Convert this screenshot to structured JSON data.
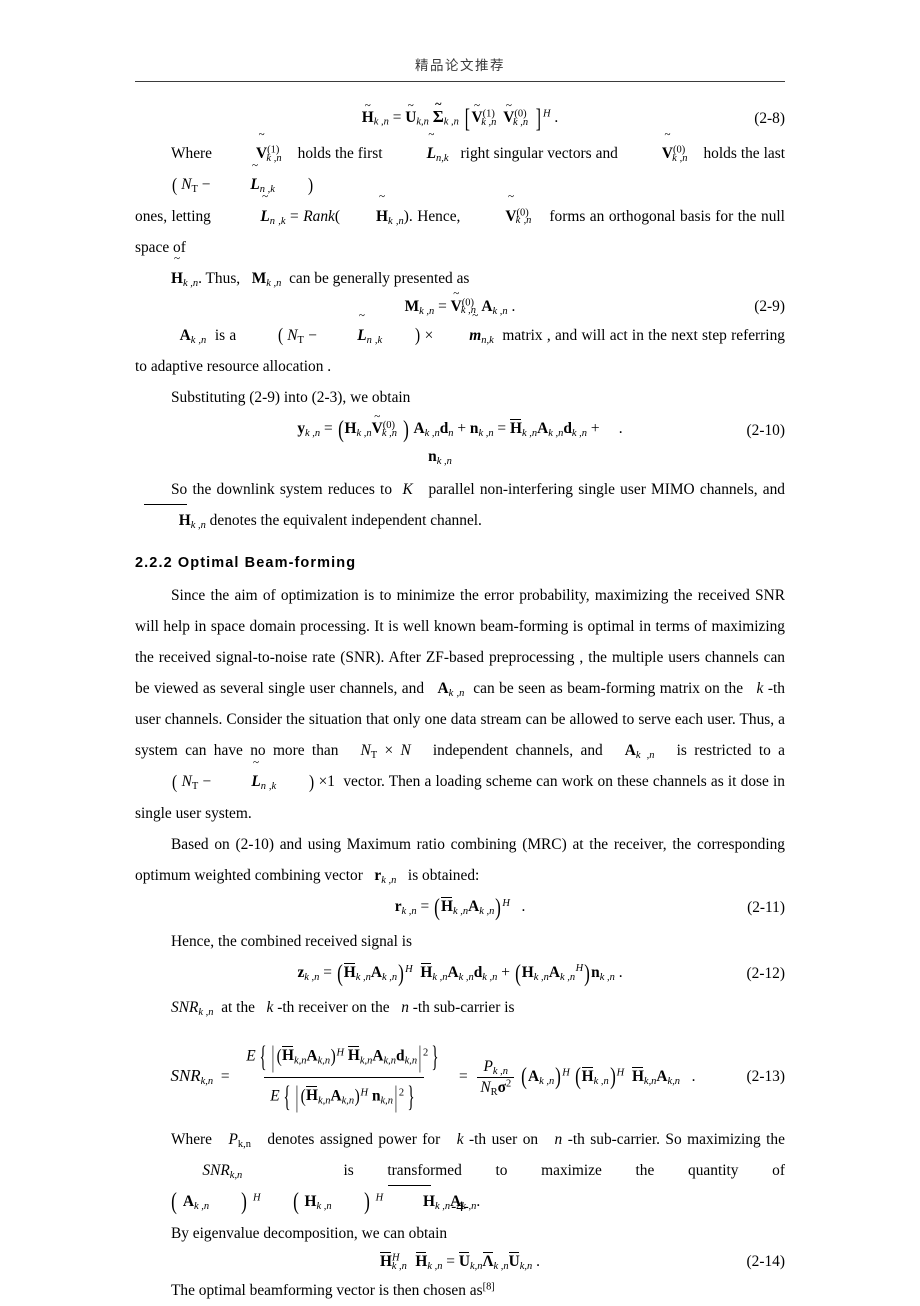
{
  "header": {
    "title": "精品论文推荐"
  },
  "equations": {
    "eq_2_8": {
      "number": "(2-8)",
      "latex": "H̃_{k,n} = Ũ_{k,n} Σ̃_{k,n} [ Ṽ^{(1)}_{k,n} Ṽ^{(0)}_{k,n} ]^{H} ."
    },
    "eq_2_9": {
      "number": "(2-9)",
      "latex": "M_{k,n} = Ṽ^{(0)}_{k,n} A_{k,n} ."
    },
    "eq_2_10": {
      "number": "(2-10)",
      "latex": "y_{k,n} = ( H_{k,n} Ṽ^{(0)}_{k,n} ) A_{k,n} d_{n} + n_{k,n} = H̄_{k,n} A_{k,n} d_{k,n} + n_{k,n} ."
    },
    "eq_2_11": {
      "number": "(2-11)",
      "latex": "r_{k,n} = ( H̄_{k,n} A_{k,n} )^{H} ."
    },
    "eq_2_12": {
      "number": "(2-12)",
      "latex": "z_{k,n} = ( H̄_{k,n} A_{k,n} )^{H} H̄_{k,n} A_{k,n} d_{k,n} + ( H_{k,n} A_{k,n} )^{H} n_{k,n} ."
    },
    "eq_2_13": {
      "number": "(2-13)",
      "latex": "SNR_{k,n} = E{ | ( H̄_{k,n} A_{k,n} )^{H} H̄_{k,n} A_{k,n} d_{k,n} |^{2} } / E{ | ( H̄_{k,n} A_{k,n} )^{H} n_{k,n} |^{2} } = ( P_{k,n} / ( N_R σ^{2} ) ) ( A_{k,n} )^{H} ( H̄_{k,n} )^{H} H̄_{k,n} A_{k,n} ."
    },
    "eq_2_14": {
      "number": "(2-14)",
      "latex": "H̄^{H}_{k,n} H̄_{k,n} = Ū_{k,n} Λ̄_{k,n} Ū_{k,n} ."
    }
  },
  "paragraphs": {
    "p1_a": "Where",
    "p1_b": "holds the first",
    "p1_c": "right singular vectors and",
    "p1_d": "holds the last",
    "p1_e": "ones, letting",
    "p1_f": ". Hence,",
    "p1_g": "forms an orthogonal basis for the null space of",
    "p1_h": ". Thus,",
    "p1_i": "can be generally presented as",
    "p2_a": "is a",
    "p2_b": "matrix , and will act in the next step referring to adaptive resource allocation .",
    "p3": "Substituting (2-9) into (2-3), we obtain",
    "p4_a": "So the downlink system reduces to",
    "p4_b": "parallel non-interfering single user MIMO channels, and",
    "p4_c": "denotes the equivalent independent channel.",
    "p5_a": "Since the aim of optimization is to minimize the error probability, maximizing the received SNR will help in space domain processing. It is well known beam-forming is optimal in terms of maximizing the received signal-to-noise rate (SNR). After ZF-based preprocessing , the multiple users channels can be viewed as several single user channels, and",
    "p5_b": "can be seen as beam-forming matrix on the",
    "p5_c": "-th user channels. Consider the situation that only one data stream can be allowed to serve each user. Thus, a system can have no more than",
    "p5_d": "independent channels, and",
    "p5_e": "is restricted to a",
    "p5_f": "vector. Then a loading scheme can work on these channels as it dose in single user system.",
    "p6_a": "Based on (2-10) and using Maximum ratio combining (MRC) at the receiver, the corresponding optimum weighted combining vector",
    "p6_b": "is obtained:",
    "p7": "Hence, the combined received signal is",
    "p8_a": "at the",
    "p8_b": "-th receiver on the",
    "p8_c": "-th sub-carrier is",
    "p9_a": "Where",
    "p9_b": "denotes assigned power for",
    "p9_c": "-th user on",
    "p9_d": "-th sub-carrier. So maximizing the",
    "p9_e": "is transformed to maximize the quantity of",
    "p9_f": ".",
    "p10": "By eigenvalue decomposition, we can obtain",
    "p11_a": "The optimal beamforming vector is then chosen as",
    "p11_ref": "[8]"
  },
  "section": {
    "heading": "2.2.2 Optimal Beam-forming"
  },
  "footer": {
    "page_number": "-4-"
  },
  "symbols": {
    "H": "H",
    "U": "U",
    "V": "V",
    "A": "A",
    "M": "M",
    "y": "y",
    "d": "d",
    "n": "n",
    "r": "r",
    "z": "z",
    "P": "P",
    "K": "K",
    "k": "k",
    "N_T": "N",
    "N_R": "N",
    "sigma": "σ",
    "Lambda": "Λ",
    "Sigma": "Σ",
    "E": "E",
    "Rank": "Rank",
    "SNR": "SNR",
    "L": "L",
    "m": "m",
    "sub_kn": "k ,n",
    "sub_nk": "n ,k",
    "sup_H": "H",
    "sup_0": "(0)",
    "sup_1": "(1)",
    "times": "×",
    "eq": "=",
    "plus": "+",
    "minus": "−"
  }
}
